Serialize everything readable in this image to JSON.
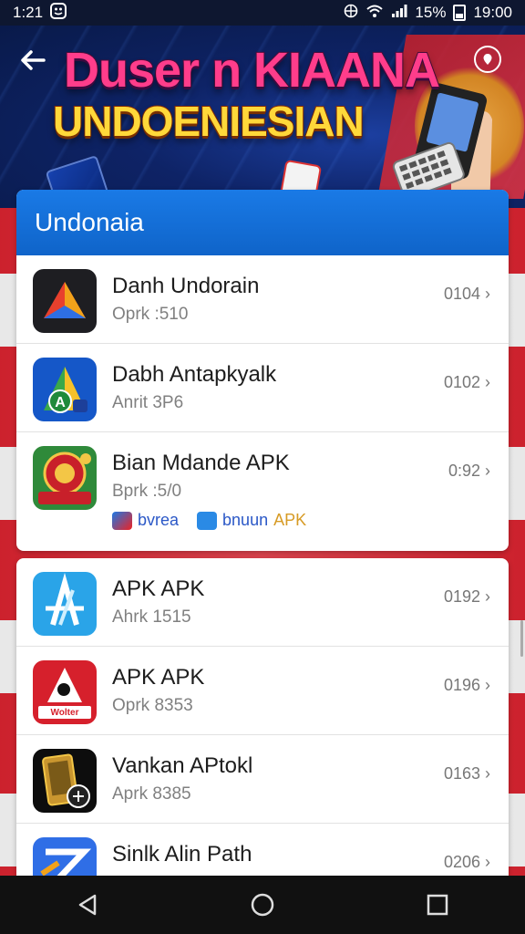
{
  "status_bar": {
    "time_left": "1:21",
    "battery_pct": "15%",
    "time_right": "19:00"
  },
  "header": {
    "title_line1": "Duser n KIAANA",
    "title_line2": "UNDOENIESIAN"
  },
  "section": {
    "title": "Undonaia"
  },
  "apps": [
    {
      "name": "Danh Undorain",
      "sub": "Oprk :510",
      "meta": "0104 ›",
      "icon": "red-triangle-icon"
    },
    {
      "name": "Dabh Antapkyalk",
      "sub": "Anrit 3P6",
      "meta": "0102 ›",
      "icon": "green-a-icon"
    },
    {
      "name": "Bian Mdande APK",
      "sub": "Bprk :5/0",
      "meta": "0:92 ›",
      "icon": "badge-icon",
      "tags": [
        {
          "label": "bvrea"
        },
        {
          "label": "bnuun",
          "suffix": "APK"
        }
      ]
    },
    {
      "name": "APK APK",
      "sub": "Ahrk 1515",
      "meta": "0192 ›",
      "icon": "blue-a-icon"
    },
    {
      "name": "APK APK",
      "sub": "Oprk 8353",
      "meta": "0196 ›",
      "icon": "red-a-icon",
      "icon_text": "Wolter"
    },
    {
      "name": "Vankan APtokl",
      "sub": "Aprk 8385",
      "meta": "0163 ›",
      "icon": "gold-phone-icon"
    },
    {
      "name": "Sinlk Alin Path",
      "sub": "",
      "meta": "0206 ›",
      "icon": "blue-z-icon"
    }
  ],
  "nav": {
    "back": "back-icon",
    "home": "home-icon",
    "recents": "recents-icon"
  }
}
